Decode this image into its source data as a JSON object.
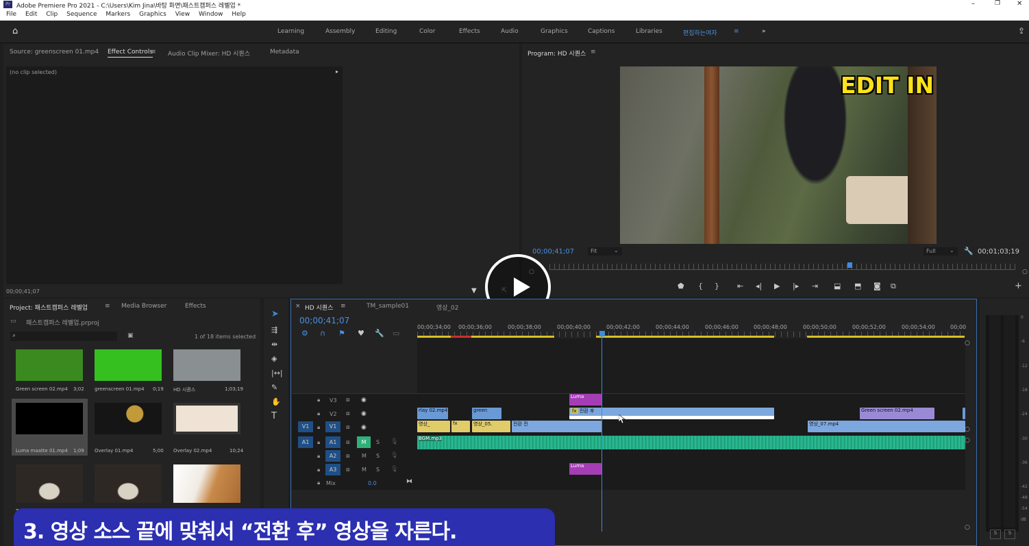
{
  "titlebar": {
    "title": "Adobe Premiere Pro 2021 - C:\\Users\\Kim Jina\\바탕 화면\\패스트캠퍼스 레벨업 *",
    "app_badge": "Pr"
  },
  "menu": [
    "File",
    "Edit",
    "Clip",
    "Sequence",
    "Markers",
    "Graphics",
    "View",
    "Window",
    "Help"
  ],
  "workspaces": [
    "Learning",
    "Assembly",
    "Editing",
    "Color",
    "Effects",
    "Audio",
    "Graphics",
    "Captions",
    "Libraries",
    "편집하는여자"
  ],
  "source_panel": {
    "tabs": [
      "Source: greenscreen 01.mp4",
      "Effect Controls",
      "Audio Clip Mixer: HD 시퀀스",
      "Metadata"
    ],
    "no_clip": "(no clip selected)",
    "timecode": "00;00;41;07"
  },
  "program": {
    "title": "Program: HD 시퀀스",
    "timecode": "00;00;41;07",
    "fit": "Fit",
    "quality": "Full",
    "duration": "00;01;03;19",
    "overlay_text": "EDIT IN"
  },
  "project": {
    "tabs": [
      "Project: 패스트캠퍼스 레벨업",
      "Media Browser",
      "Effects"
    ],
    "file": "패스트캠퍼스 레벨업.prproj",
    "selection": "1 of 18 items selected",
    "items": [
      {
        "name": "Green screen 02.mp4",
        "dur": "3;02",
        "color": "#3a8a20"
      },
      {
        "name": "greenscreen 01.mp4",
        "dur": "0;19",
        "color": "#35c020"
      },
      {
        "name": "HD 시퀀스",
        "dur": "1;03;19",
        "color": "#8a8f92"
      },
      {
        "name": "Luma maatte 01.mp4",
        "dur": "1;09",
        "color": "#000000"
      },
      {
        "name": "Overlay 01.mp4",
        "dur": "5;00",
        "color": "#151515"
      },
      {
        "name": "Overlay 02.mp4",
        "dur": "10;24",
        "color": "#efe3d5"
      },
      {
        "name": "T",
        "dur": "",
        "color": "#3a3530"
      },
      {
        "name": "",
        "dur": "",
        "color": "#3a3530"
      },
      {
        "name": "",
        "dur": "",
        "color": "#d9a86a"
      }
    ]
  },
  "timeline": {
    "tabs": [
      "HD 시퀀스",
      "TM_sample01",
      "영상_02"
    ],
    "timecode": "00;00;41;07",
    "ruler": [
      "00;00;34;00",
      "00;00;36;00",
      "00;00;38;00",
      "00;00;40;00",
      "00;00;42;00",
      "00;00;44;00",
      "00;00;46;00",
      "00;00;48;00",
      "00;00;50;00",
      "00;00;52;00",
      "00;00;54;00",
      "00;00"
    ],
    "tracks": {
      "v3": "V3",
      "v2": "V2",
      "v1": "V1",
      "a1": "A1",
      "a2": "A2",
      "a3": "A3",
      "src_v1": "V1",
      "src_a1": "A1",
      "mix": "Mix",
      "mix_val": "0.0",
      "m": "M",
      "s": "S"
    },
    "clips": {
      "luma_v3": "Luma",
      "fx": "fx",
      "after": "전환 후",
      "green": "green",
      "overlay02": "rlay 02.mp4",
      "gs02": "Green screen 02.mp4",
      "vid_a": "영상_",
      "vid_05": "영상_05.",
      "before": "전환 전",
      "vid_07": "영상_07.mp4",
      "bgm": "BGM.mp3",
      "luma_a3": "Luma"
    }
  },
  "meter": {
    "ticks": [
      "0",
      "-6",
      "-12",
      "-18",
      "-24",
      "-30",
      "-36",
      "-42",
      "-48",
      "-54",
      "dB"
    ],
    "s_label": "S"
  },
  "caption": "3. 영상 소스 끝에 맞춰서 “전환 후” 영상을 자른다."
}
